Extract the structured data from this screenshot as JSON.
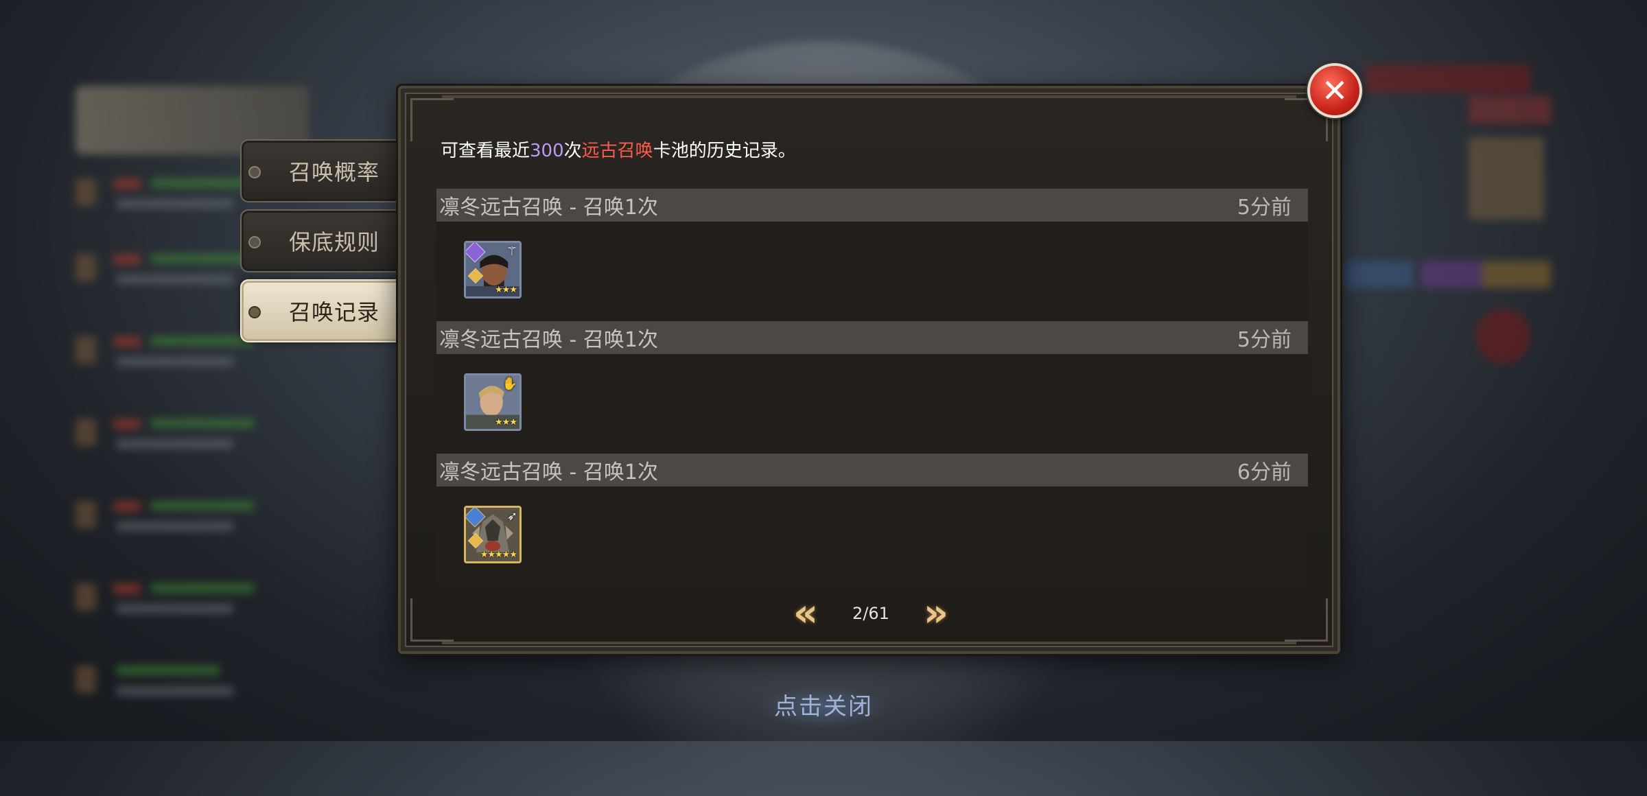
{
  "side_tabs": [
    {
      "label": "召唤概率",
      "active": false
    },
    {
      "label": "保底规则",
      "active": false
    },
    {
      "label": "召唤记录",
      "active": true
    }
  ],
  "dialog": {
    "description": {
      "prefix": "可查看最近",
      "count": "300",
      "mid": "次",
      "pool": "远古召唤",
      "suffix": "卡池的历史记录。"
    },
    "records": [
      {
        "title": "凛冬远古召唤 - 召唤1次",
        "time": "5分前",
        "hero": {
          "stars": "★★★",
          "class_icon": "staff-icon",
          "frame": "blue"
        }
      },
      {
        "title": "凛冬远古召唤 - 召唤1次",
        "time": "5分前",
        "hero": {
          "stars": "★★★",
          "class_icon": "hands-icon",
          "frame": "blue"
        }
      },
      {
        "title": "凛冬远古召唤 - 召唤1次",
        "time": "6分前",
        "hero": {
          "stars": "★★★★★",
          "class_icon": "bow-icon",
          "frame": "gold"
        }
      }
    ],
    "pager": {
      "prev": "«",
      "next": "»",
      "text": "2/61"
    }
  },
  "close_button": "✕",
  "tap_to_close": "点击关闭",
  "colors": {
    "highlight_count": "#b79df4",
    "highlight_pool": "#ff5a4e",
    "pager_arrow": "#e8c58a"
  }
}
